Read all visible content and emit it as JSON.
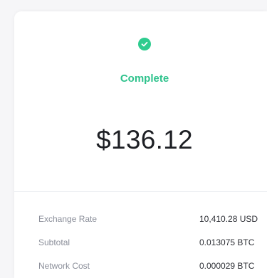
{
  "status": {
    "icon": "check-circle-icon",
    "label": "Complete",
    "color": "#2ecc8f"
  },
  "amount": "$136.12",
  "details": [
    {
      "label": "Exchange Rate",
      "value": "10,410.28 USD"
    },
    {
      "label": "Subtotal",
      "value": "0.013075 BTC"
    },
    {
      "label": "Network Cost",
      "value": "0.000029 BTC"
    }
  ]
}
